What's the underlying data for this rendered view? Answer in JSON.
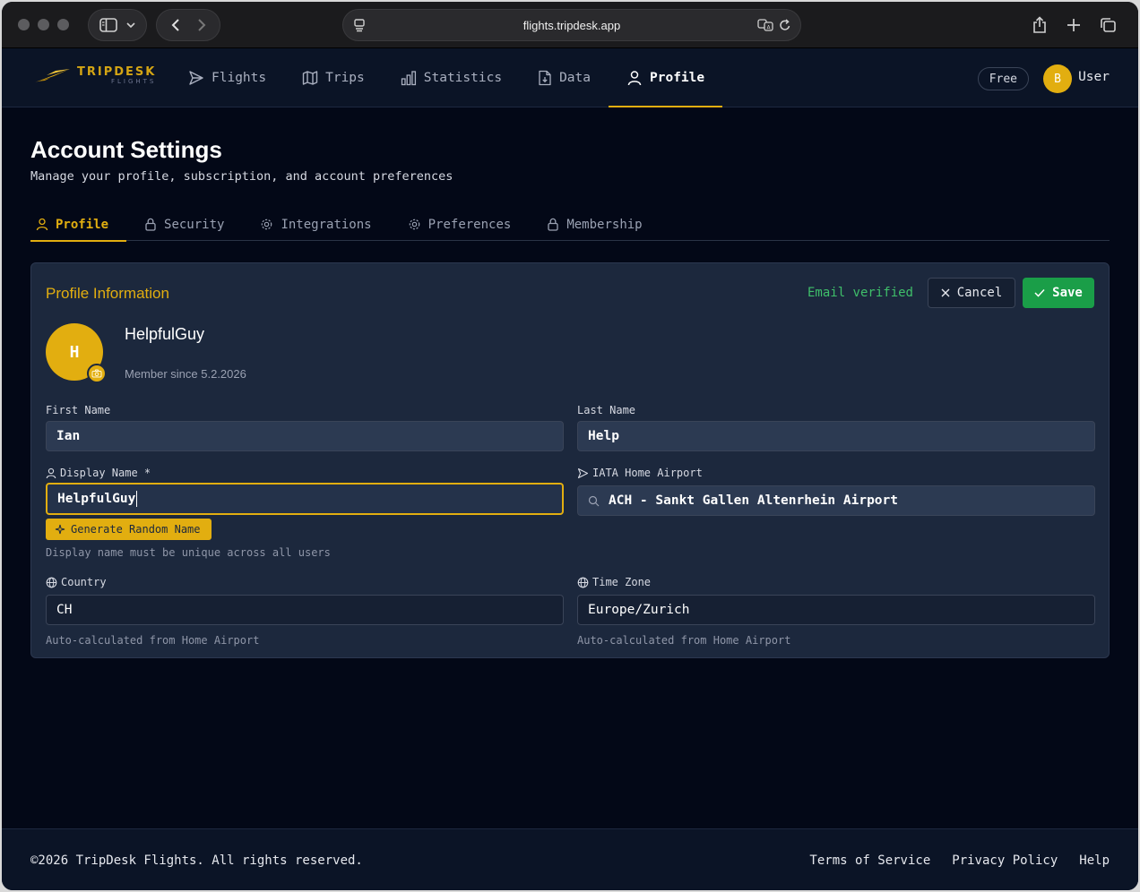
{
  "browser": {
    "url": "flights.tripdesk.app"
  },
  "brand": {
    "name": "TRIPDESK",
    "sub": "FLIGHTS",
    "accent": "#e2ae10"
  },
  "nav": {
    "items": [
      {
        "label": "Flights",
        "icon": "send-icon"
      },
      {
        "label": "Trips",
        "icon": "map-icon"
      },
      {
        "label": "Statistics",
        "icon": "bar-chart-icon"
      },
      {
        "label": "Data",
        "icon": "file-download-icon"
      },
      {
        "label": "Profile",
        "icon": "user-icon",
        "active": true
      }
    ],
    "plan": "Free",
    "user_initial": "B",
    "user_name": "User"
  },
  "page": {
    "title": "Account Settings",
    "subtitle": "Manage your profile, subscription, and account preferences",
    "tabs": [
      {
        "label": "Profile",
        "icon": "user-icon",
        "active": true
      },
      {
        "label": "Security",
        "icon": "lock-icon"
      },
      {
        "label": "Integrations",
        "icon": "gear-icon"
      },
      {
        "label": "Preferences",
        "icon": "gear-icon"
      },
      {
        "label": "Membership",
        "icon": "lock-icon"
      }
    ]
  },
  "profile": {
    "section_title": "Profile Information",
    "email_status": "Email verified",
    "cancel_label": "Cancel",
    "save_label": "Save",
    "avatar_initial": "H",
    "display_name": "HelpfulGuy",
    "member_since": "Member since 5.2.2026",
    "first_name": {
      "label": "First Name",
      "value": "Ian"
    },
    "last_name": {
      "label": "Last Name",
      "value": "Help"
    },
    "display_name_field": {
      "label": "Display Name *",
      "value": "HelpfulGuy"
    },
    "generate_label": "Generate Random Name",
    "display_hint": "Display name must be unique across all users",
    "home_airport": {
      "label": "IATA Home Airport",
      "value": "ACH - Sankt Gallen Altenrhein Airport"
    },
    "country": {
      "label": "Country",
      "value": "CH",
      "hint": "Auto-calculated from Home Airport"
    },
    "timezone": {
      "label": "Time Zone",
      "value": "Europe/Zurich",
      "hint": "Auto-calculated from Home Airport"
    }
  },
  "footer": {
    "copyright": "©2026 TripDesk Flights. All rights reserved.",
    "links": [
      "Terms of Service",
      "Privacy Policy",
      "Help"
    ]
  }
}
